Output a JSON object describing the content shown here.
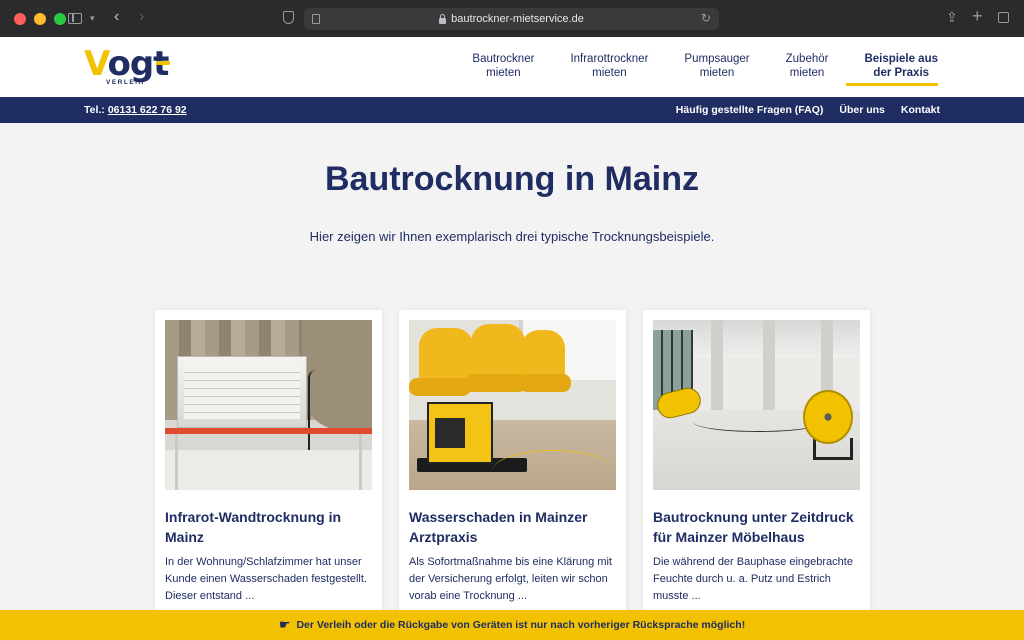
{
  "browser": {
    "url": "bautrockner-mietservice.de"
  },
  "logo": {
    "text_v": "V",
    "text_rest": "ogt",
    "subtitle": "VERLEIH"
  },
  "nav": {
    "items": [
      {
        "line1": "Bautrockner",
        "line2": "mieten"
      },
      {
        "line1": "Infrarottrockner",
        "line2": "mieten"
      },
      {
        "line1": "Pumpsauger",
        "line2": "mieten"
      },
      {
        "line1": "Zubehör",
        "line2": "mieten"
      },
      {
        "line1": "Beispiele aus",
        "line2": "der Praxis",
        "active": true
      }
    ]
  },
  "topbar": {
    "phone_label": "Tel.:",
    "phone_number": "06131 622 76 92",
    "links": [
      "Häufig gestellte Fragen (FAQ)",
      "Über uns",
      "Kontakt"
    ]
  },
  "hero": {
    "title": "Bautrocknung in Mainz",
    "lead": "Hier zeigen wir Ihnen exemplarisch drei typische Trocknungsbeispiele."
  },
  "cards": [
    {
      "title": "Infrarot-Wandtrocknung in Mainz",
      "text": "In der Wohnung/Schlafzimmer hat unser Kunde einen Wasserschaden fest­gestellt. Dieser entstand ..."
    },
    {
      "title": "Wasserschaden in Mainzer Arztpraxis",
      "text": "Als Sofortmaßnahme bis eine Klärung mit der Versicherung erfolgt, leiten wir schon vorab eine Trocknung ..."
    },
    {
      "title": "Bautrocknung unter Zeitdruck für Mainzer Möbelhaus",
      "text": "Die während der Bauphase einge­brachte Feuchte durch u. a. Putz und Estrich musste ..."
    }
  ],
  "notice": {
    "text": "Der Verleih oder die Rückgabe von Geräten ist nur nach vorheriger Rücksprache möglich!"
  },
  "colors": {
    "brand_blue": "#1f2d63",
    "brand_yellow": "#f2c200"
  }
}
